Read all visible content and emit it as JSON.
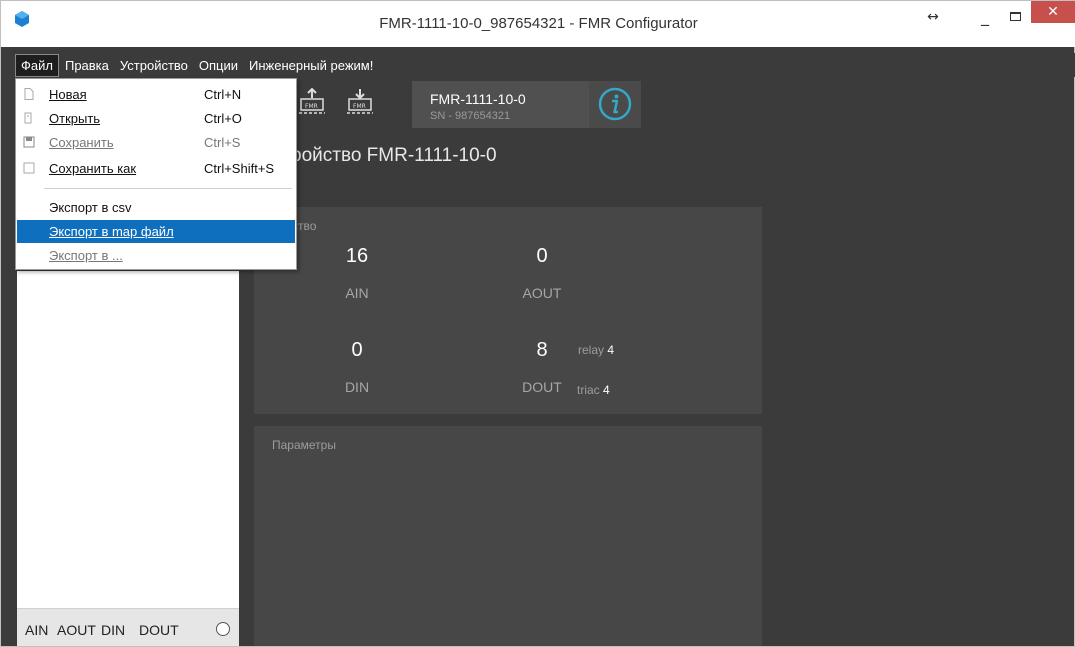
{
  "window": {
    "title": "FMR-1111-10-0_987654321 - FMR Configurator",
    "resize_icon": "↔",
    "minimize_icon": "_",
    "close_icon": "✕"
  },
  "menubar": {
    "items": [
      "Файл",
      "Правка",
      "Устройство",
      "Опции",
      "Инженерный режим!"
    ]
  },
  "file_menu": {
    "new": {
      "label": "Новая",
      "shortcut": "Ctrl+N"
    },
    "open": {
      "label": "Открыть",
      "shortcut": "Ctrl+O"
    },
    "save": {
      "label": "Сохранить",
      "shortcut": "Ctrl+S"
    },
    "save_as": {
      "label": "Сохранить как",
      "shortcut": "Ctrl+Shift+S"
    },
    "export_csv": {
      "label": "Экспорт в csv"
    },
    "export_map": {
      "label": "Экспорт в map файл"
    },
    "export_other": {
      "label": "Экспорт в ..."
    }
  },
  "toolbar": {
    "device_name": "FMR-1111-10-0",
    "serial": "SN - 987654321",
    "icon_label": "FMR"
  },
  "heading": "ройство FMR-1111-10-0",
  "device_panel": {
    "label": "ройство",
    "ain": {
      "value": "16",
      "label": "AIN"
    },
    "aout": {
      "value": "0",
      "label": "AOUT"
    },
    "din": {
      "value": "0",
      "label": "DIN"
    },
    "dout": {
      "value": "8",
      "label": "DOUT"
    },
    "relay": {
      "label": "relay",
      "value": "4"
    },
    "triac": {
      "label": "triac",
      "value": "4"
    }
  },
  "params_panel": {
    "label": "Параметры"
  },
  "channel_filter": [
    "AIN",
    "AOUT",
    "DIN",
    "DOUT"
  ],
  "colors": {
    "window_bg": "#3b3b3b",
    "panel_bg": "#474747",
    "selection": "#0f6fbf",
    "close_button": "#c7504d"
  }
}
